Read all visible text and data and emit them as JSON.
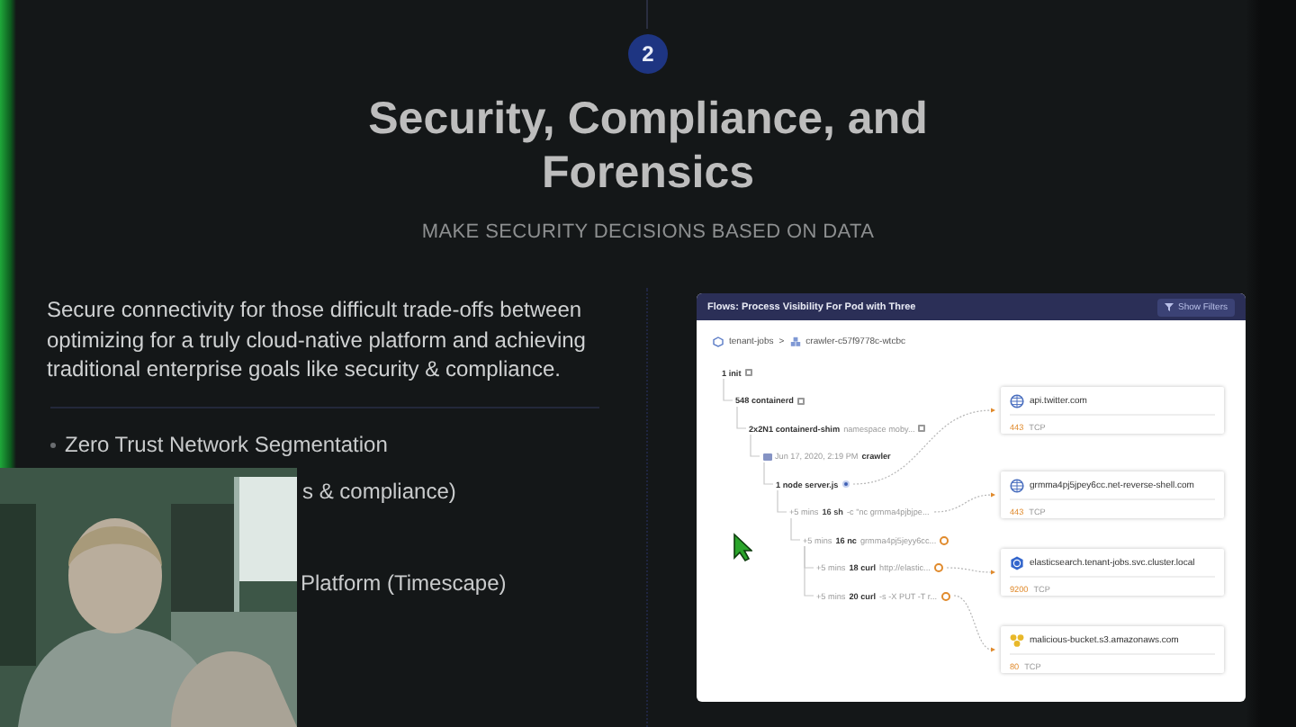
{
  "step_badge": "2",
  "title": "Security, Compliance, and Forensics",
  "subtitle": "MAKE SECURITY DECISIONS BASED ON DATA",
  "intro": "Secure connectivity for those difficult trade-offs between optimizing for a truly cloud-native platform and achieving traditional enterprise goals like security & compliance.",
  "features": [
    "Zero Trust Network Segmentation",
    "s & compliance)",
    "Platform (Timescape)"
  ],
  "flow_panel": {
    "title": "Flows: Process Visibility For Pod with Three",
    "filter_button": "Show Filters",
    "breadcrumb": [
      {
        "label": "tenant-jobs",
        "kind": "namespace"
      },
      {
        "label": "crawler-c57f9778c-wtcbc",
        "kind": "pod"
      }
    ],
    "breadcrumb_separator": ">",
    "tree": [
      {
        "kind": "process",
        "name": "1 init",
        "children": [
          {
            "kind": "process",
            "name": "548 containerd",
            "children": [
              {
                "kind": "process",
                "name": "2x2N1 containerd-shim",
                "args": "namespace moby...",
                "children": [
                  {
                    "kind": "pod",
                    "prefix": "Jun 17, 2020, 2:19 PM",
                    "name": "crawler",
                    "children": [
                      {
                        "kind": "app",
                        "name": "1 node server.js",
                        "children": [
                          {
                            "kind": "plain",
                            "prefix": "+5 mins",
                            "name": "16 sh",
                            "args": "-c \"nc grmma4pjbjpe...",
                            "children": [
                              {
                                "kind": "flagged",
                                "prefix": "+5 mins",
                                "name": "16 nc",
                                "args": "grmma4pj5jeyy6cc...",
                                "children": [
                                  {
                                    "kind": "flagged",
                                    "prefix": "+5 mins",
                                    "name": "18 curl",
                                    "args": "http://elastic..."
                                  },
                                  {
                                    "kind": "flagged",
                                    "prefix": "+5 mins",
                                    "name": "20 curl",
                                    "args": "-s -X PUT -T r..."
                                  }
                                ]
                              }
                            ]
                          }
                        ]
                      }
                    ]
                  }
                ]
              }
            ]
          }
        ]
      }
    ],
    "destinations": [
      {
        "kind": "web",
        "host": "api.twitter.com",
        "port": "443",
        "protocol": "TCP"
      },
      {
        "kind": "web",
        "host": "grmma4pj5jpey6cc.net-reverse-shell.com",
        "port": "443",
        "protocol": "TCP"
      },
      {
        "kind": "service",
        "host": "elasticsearch.tenant-jobs.svc.cluster.local",
        "port": "9200",
        "protocol": "TCP"
      },
      {
        "kind": "bucket",
        "host": "malicious-bucket.s3.amazonaws.com",
        "port": "80",
        "protocol": "TCP"
      }
    ]
  },
  "webcam": {
    "kind": "picture"
  }
}
